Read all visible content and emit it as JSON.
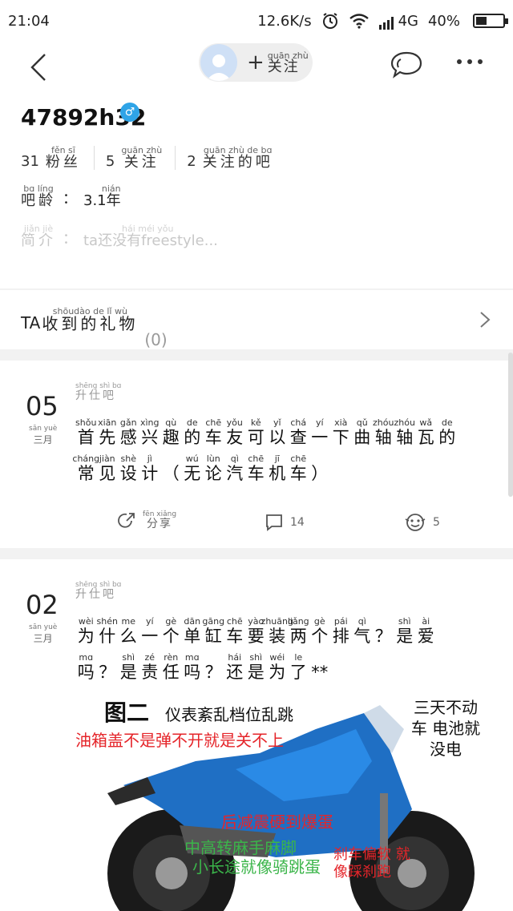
{
  "status_bar": {
    "time": "21:04",
    "speed": "12.6K/s",
    "network": "4G",
    "battery": "40%",
    "battery_level": 0.4
  },
  "nav": {
    "follow": {
      "pinyin": "guān zhù",
      "label": "关注",
      "plus": "+"
    }
  },
  "profile": {
    "username": "47892h32",
    "gender_icon": "male-icon",
    "stats": [
      {
        "num": "31",
        "pinyin": "fěn sī",
        "label": "粉丝"
      },
      {
        "num": "5",
        "pinyin": "guān zhù",
        "label": "关注"
      },
      {
        "num": "2",
        "pinyin": "guān zhù de bɑ",
        "label": "关注的吧"
      }
    ],
    "age": {
      "pinyin": "bɑ líng",
      "label": "吧龄",
      "sep": "：",
      "value": "3.1年",
      "value_pinyin": "nián"
    },
    "intro": {
      "pinyin": "jiǎn jiè",
      "label": "简介",
      "sep": "：",
      "value": "ta还没有freestyle...",
      "value_pinyin": "hái méi yǒu"
    }
  },
  "gifts": {
    "prefix": "TA",
    "pinyin": "shōudào de lǐ wù",
    "label": "收到的礼物",
    "count": "(0)"
  },
  "posts": [
    {
      "day": "05",
      "month_pinyin": "sān yuè",
      "month": "三月",
      "forum_pinyin": "shēng shì bɑ",
      "forum": "升仕吧",
      "lines": [
        [
          [
            "shǒu",
            "首"
          ],
          [
            "xiān",
            "先"
          ],
          [
            "gǎn",
            "感"
          ],
          [
            "xìng",
            "兴"
          ],
          [
            "qù",
            "趣"
          ],
          [
            "de",
            "的"
          ],
          [
            "chē",
            "车"
          ],
          [
            "yǒu",
            "友"
          ],
          [
            "kě",
            "可"
          ],
          [
            "yǐ",
            "以"
          ],
          [
            "chá",
            "查"
          ],
          [
            "yí",
            "一"
          ],
          [
            "xià",
            "下"
          ],
          [
            "qǔ",
            "曲"
          ],
          [
            "zhóu",
            "轴"
          ],
          [
            "zhóu",
            "轴"
          ],
          [
            "wǎ",
            "瓦"
          ],
          [
            "de",
            "的"
          ]
        ],
        [
          [
            "cháng",
            "常"
          ],
          [
            "jiàn",
            "见"
          ],
          [
            "shè",
            "设"
          ],
          [
            "jì",
            "计"
          ],
          [
            "",
            "（"
          ],
          [
            "wú",
            "无"
          ],
          [
            "lùn",
            "论"
          ],
          [
            "qì",
            "汽"
          ],
          [
            "chē",
            "车"
          ],
          [
            "jī",
            "机"
          ],
          [
            "chē",
            "车"
          ],
          [
            "",
            "）"
          ]
        ]
      ],
      "share": {
        "pinyin": "fēn xiǎng",
        "label": "分享"
      },
      "comments": "14",
      "likes": "5"
    },
    {
      "day": "02",
      "month_pinyin": "sān yuè",
      "month": "三月",
      "forum_pinyin": "shēng shì bɑ",
      "forum": "升仕吧",
      "lines": [
        [
          [
            "wèi",
            "为"
          ],
          [
            "shén",
            "什"
          ],
          [
            "me",
            "么"
          ],
          [
            "yí",
            "一"
          ],
          [
            "gè",
            "个"
          ],
          [
            "dān",
            "单"
          ],
          [
            "gāng",
            "缸"
          ],
          [
            "chē",
            "车"
          ],
          [
            "yào",
            "要"
          ],
          [
            "zhuāng",
            "装"
          ],
          [
            "liǎng",
            "两"
          ],
          [
            "gè",
            "个"
          ],
          [
            "pái",
            "排"
          ],
          [
            "qì",
            "气"
          ],
          [
            "",
            "？"
          ],
          [
            "shì",
            "是"
          ],
          [
            "ài",
            "爱"
          ]
        ],
        [
          [
            "mɑ",
            "吗"
          ],
          [
            "",
            "？"
          ],
          [
            "shì",
            "是"
          ],
          [
            "zé",
            "责"
          ],
          [
            "rèn",
            "任"
          ],
          [
            "mɑ",
            "吗"
          ],
          [
            "",
            "？"
          ],
          [
            "hái",
            "还"
          ],
          [
            "shì",
            "是"
          ],
          [
            "wéi",
            "为"
          ],
          [
            "le",
            "了"
          ],
          [
            "",
            "**"
          ]
        ]
      ],
      "image_captions": {
        "title": "图二",
        "c1": "仪表紊乱档位乱跳",
        "c2": "油箱盖不是弹不开就是关不上",
        "c3": "三天不动车 电池就没电",
        "c4": "后减震硬到爆蛋",
        "c5": "中高转麻手麻脚",
        "c6": "小长途就像骑跳蛋",
        "c7": "刹车偏软 就像踩刹跑"
      }
    }
  ]
}
